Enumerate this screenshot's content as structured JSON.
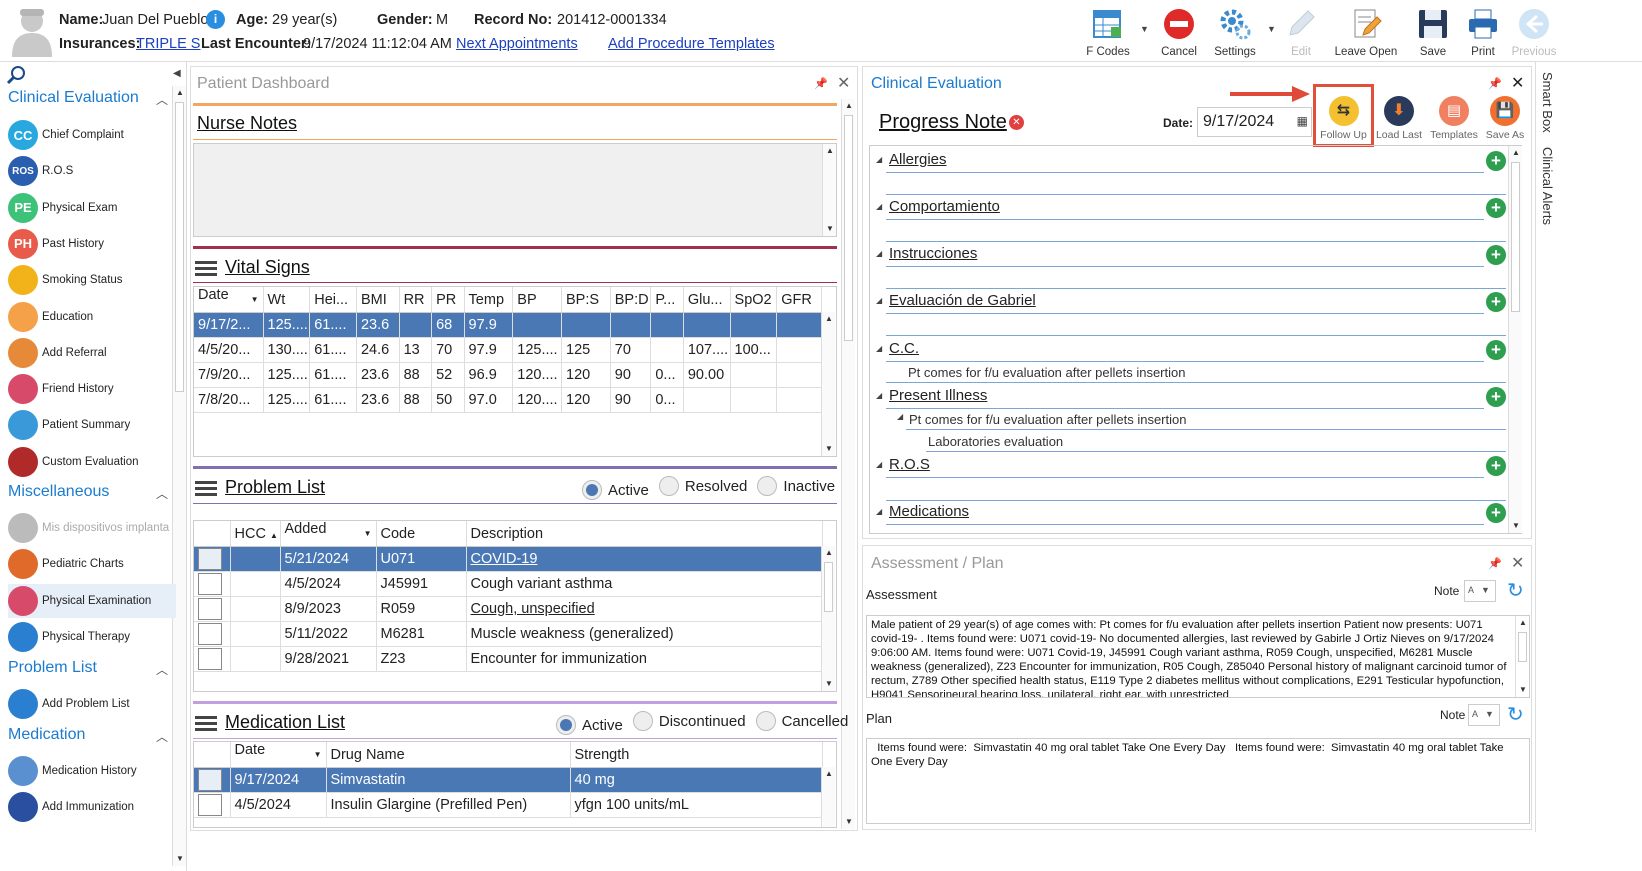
{
  "header": {
    "name_label": "Name:",
    "name": "Juan Del Pueblo",
    "age_label": "Age:",
    "age": "29 year(s)",
    "gender_label": "Gender:",
    "gender": "M",
    "record_label": "Record No:",
    "record": "201412-0001334",
    "insurances_label": "Insurances:",
    "insurance": "TRIPLE S",
    "last_encounter_label": "Last Encounter:",
    "last_encounter": "9/17/2024 11:12:04 AM",
    "next_appointments": "Next Appointments",
    "add_procedure_templates": "Add Procedure Templates"
  },
  "toolbar": {
    "f_codes": "F Codes",
    "cancel": "Cancel",
    "settings": "Settings",
    "edit": "Edit",
    "leave_open": "Leave Open",
    "save": "Save",
    "print": "Print",
    "previous": "Previous"
  },
  "sidebar": {
    "clinical_evaluation": "Clinical Evaluation",
    "items": [
      {
        "label": "Chief Complaint",
        "abbr": "CC",
        "color": "#29a8df"
      },
      {
        "label": "R.O.S",
        "abbr": "ROS",
        "color": "#2a5fb0"
      },
      {
        "label": "Physical Exam",
        "abbr": "PE",
        "color": "#3ec27a"
      },
      {
        "label": "Past History",
        "abbr": "PH",
        "color": "#e85a4a"
      },
      {
        "label": "Smoking Status",
        "abbr": "",
        "color": "#f2b31a"
      },
      {
        "label": "Education",
        "abbr": "",
        "color": "#f5a14a"
      },
      {
        "label": "Add Referral",
        "abbr": "",
        "color": "#e68a3a"
      },
      {
        "label": "Friend History",
        "abbr": "",
        "color": "#d84a6a"
      },
      {
        "label": "Patient Summary",
        "abbr": "",
        "color": "#3a9ad9"
      },
      {
        "label": "Custom Evaluation",
        "abbr": "",
        "color": "#b02a2a"
      }
    ],
    "miscellaneous": "Miscellaneous",
    "misc_items": [
      {
        "label": "Mis dispositivos implanta",
        "color": "#bbbbbb"
      },
      {
        "label": "Pediatric Charts",
        "color": "#e06a2a"
      },
      {
        "label": "Physical Examination",
        "color": "#d84a6a"
      },
      {
        "label": "Physical Therapy",
        "color": "#2a7fd0"
      }
    ],
    "problem_list": "Problem List",
    "problem_items": [
      {
        "label": "Add Problem List",
        "color": "#2a7fd0"
      }
    ],
    "medication": "Medication",
    "medication_items": [
      {
        "label": "Medication History",
        "color": "#5a8fd0"
      },
      {
        "label": "Add Immunization",
        "color": "#2a4fa0"
      }
    ]
  },
  "dashboard": {
    "title": "Patient Dashboard",
    "nurse_notes": "Nurse Notes",
    "vital_signs": "Vital Signs",
    "vital_headers": [
      "Date",
      "Wt",
      "Hei...",
      "BMI",
      "RR",
      "PR",
      "Temp",
      "BP",
      "BP:S",
      "BP:D",
      "P...",
      "Glu...",
      "SpO2",
      "GFR"
    ],
    "vital_rows": [
      [
        "9/17/2...",
        "125....",
        "61....",
        "23.6",
        "",
        "68",
        "97.9",
        "",
        "",
        "",
        "",
        "",
        "",
        ""
      ],
      [
        "4/5/20...",
        "130....",
        "61....",
        "24.6",
        "13",
        "70",
        "97.9",
        "125....",
        "125",
        "70",
        "",
        "107....",
        "100...",
        ""
      ],
      [
        "7/9/20...",
        "125....",
        "61....",
        "23.6",
        "88",
        "52",
        "96.9",
        "120....",
        "120",
        "90",
        "0...",
        "90.00",
        "",
        ""
      ],
      [
        "7/8/20...",
        "125....",
        "61....",
        "23.6",
        "88",
        "50",
        "97.0",
        "120....",
        "120",
        "90",
        "0...",
        "",
        "",
        ""
      ]
    ],
    "problem_list": "Problem List",
    "problem_radios": [
      "Active",
      "Resolved",
      "Inactive"
    ],
    "problem_headers": [
      "HCC",
      "Added",
      "Code",
      "Description"
    ],
    "problem_rows": [
      {
        "added": "5/21/2024",
        "code": "U071",
        "desc": "COVID-19",
        "link": true
      },
      {
        "added": "4/5/2024",
        "code": "J45991",
        "desc": "Cough variant asthma",
        "link": false
      },
      {
        "added": "8/9/2023",
        "code": "R059",
        "desc": "Cough, unspecified",
        "link": true
      },
      {
        "added": "5/11/2022",
        "code": "M6281",
        "desc": "Muscle weakness (generalized)",
        "link": false
      },
      {
        "added": "9/28/2021",
        "code": "Z23",
        "desc": "Encounter for immunization",
        "link": false
      }
    ],
    "medication_list": "Medication List",
    "med_radios": [
      "Active",
      "Discontinued",
      "Cancelled"
    ],
    "med_headers": [
      "Date",
      "Drug Name",
      "Strength"
    ],
    "med_rows": [
      [
        "9/17/2024",
        "Simvastatin",
        "40 mg"
      ],
      [
        "4/5/2024",
        "Insulin Glargine (Prefilled Pen)",
        "yfgn 100 units/mL"
      ]
    ]
  },
  "clinical": {
    "title": "Clinical Evaluation",
    "progress_note": "Progress Note",
    "date_label": "Date:",
    "date_value": "9/17/2024",
    "follow_up": "Follow Up",
    "load_last": "Load Last",
    "templates": "Templates",
    "save_as": "Save As",
    "sections": [
      "Allergies",
      "Comportamiento",
      "Instrucciones",
      "Evaluación de Gabriel",
      "C.C.",
      "Present Illness",
      "R.O.S",
      "Medications"
    ],
    "cc_text": "Pt comes for f/u evaluation after pellets insertion",
    "pi_text": "Pt comes for f/u evaluation after pellets insertion",
    "pi_sub": "Laboratories evaluation"
  },
  "right_tabs": [
    "Smart Box",
    "Clinical Alerts"
  ],
  "assessment": {
    "title": "Assessment / Plan",
    "assessment_label": "Assessment",
    "note_label": "Note",
    "assessment_text": "Male patient of 29 year(s) of age comes with:  Pt comes for f/u evaluation after pellets insertion  Patient now presents: U071 covid-19- . Items found were:  U071 covid-19-    No documented allergies, last reviewed by Gabirle J Ortiz Nieves on 9/17/2024 9:06:00 AM.    Items found were:  U071 Covid-19, J45991 Cough variant asthma, R059 Cough, unspecified, M6281 Muscle weakness (generalized), Z23 Encounter for immunization, R05 Cough, Z85040 Personal history of malignant carcinoid tumor of rectum, Z789 Other specified health status, E119 Type 2 diabetes mellitus without complications, E291 Testicular hypofunction, H9041 Sensorineural hearing loss, unilateral, right ear, with unrestricted",
    "plan_label": "Plan",
    "plan_text": "  Items found were:  Simvastatin 40 mg oral tablet Take One Every Day   Items found were:  Simvastatin 40 mg oral tablet Take One Every Day"
  }
}
